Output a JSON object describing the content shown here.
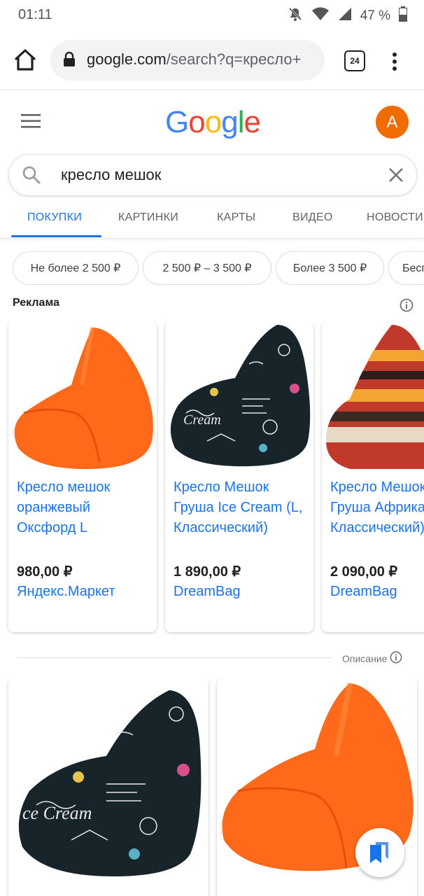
{
  "status": {
    "time": "01:11",
    "battery": "47 %"
  },
  "browser": {
    "url_domain": "google.com",
    "url_path": "/search?q=кресло+",
    "tab_count": "24"
  },
  "header": {
    "logo": [
      "G",
      "o",
      "o",
      "g",
      "l",
      "e"
    ],
    "avatar_letter": "A"
  },
  "search": {
    "query": "кресло мешок"
  },
  "tabs": [
    {
      "label": "ПОКУПКИ"
    },
    {
      "label": "КАРТИНКИ"
    },
    {
      "label": "КАРТЫ"
    },
    {
      "label": "ВИДЕО"
    },
    {
      "label": "НОВОСТИ"
    }
  ],
  "chips": [
    {
      "label": "Не более 2 500 ₽"
    },
    {
      "label": "2 500 ₽ – 3 500 ₽"
    },
    {
      "label": "Более 3 500 ₽"
    },
    {
      "label": "Бесп"
    }
  ],
  "ads": {
    "label": "Реклама",
    "items": [
      {
        "title": "Кресло мешок\nоранжевый\nОксфорд L",
        "price": "980,00 ₽",
        "store": "Яндекс.Маркет"
      },
      {
        "title": "Кресло Мешок\nГруша Ice Cream (L,\nКлассический)",
        "price": "1 890,00 ₽",
        "store": "DreamBag"
      },
      {
        "title": "Кресло Мешок\nГруша Африка\nКлассический)",
        "price": "2 090,00 ₽",
        "store": "DreamBag"
      }
    ]
  },
  "description": {
    "label": "Описание"
  },
  "colors": {
    "accent": "#1a73e8",
    "avatar": "#ef6c00",
    "bag_orange": "#ff6a1a"
  }
}
